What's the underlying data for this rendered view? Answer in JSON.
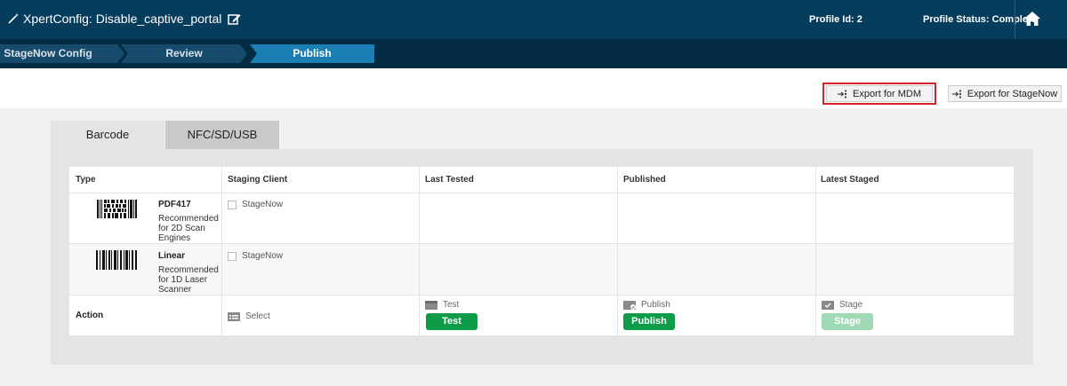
{
  "header": {
    "title": "XpertConfig: Disable_captive_portal",
    "profile_id": "Profile Id: 2",
    "profile_status": "Profile Status: Complete",
    "icons": [
      "magic-wand-icon",
      "edit-icon",
      "home-icon"
    ]
  },
  "steps": [
    {
      "label": "StageNow Config",
      "state": "done"
    },
    {
      "label": "Review",
      "state": "done"
    },
    {
      "label": "Publish",
      "state": "active"
    }
  ],
  "export": {
    "mdm_label": "Export for MDM",
    "stagenow_label": "Export for StageNow",
    "highlight_color": "#d4222a"
  },
  "tabs": [
    {
      "label": "Barcode",
      "selected": true
    },
    {
      "label": "NFC/SD/USB",
      "selected": false
    }
  ],
  "table": {
    "headers": [
      "Type",
      "Staging Client",
      "Last Tested",
      "Published",
      "Latest Staged"
    ],
    "rows": [
      {
        "name": "PDF417",
        "desc": "Recommended for 2D Scan Engines",
        "client": "StageNow"
      },
      {
        "name": "Linear",
        "desc": "Recommended for 1D Laser Scanner",
        "client": "StageNow"
      }
    ],
    "action": {
      "label": "Action",
      "select": "Select",
      "test_title": "Test",
      "test_button": "Test",
      "publish_title": "Publish",
      "publish_button": "Publish",
      "stage_title": "Stage",
      "stage_button": "Stage"
    }
  },
  "colors": {
    "header_bg": "#063c5c",
    "active_step": "#1c7fb4",
    "green_button": "#0e9c48"
  }
}
